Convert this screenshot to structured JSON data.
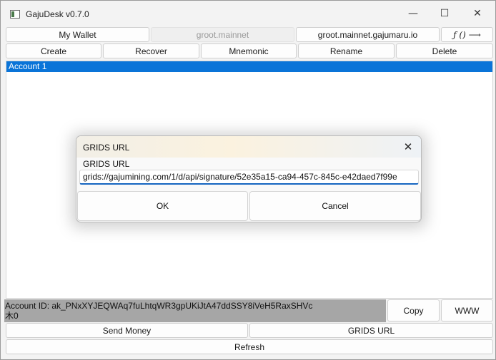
{
  "window": {
    "title": "GajuDesk v0.7.0",
    "minimize": "—",
    "maximize": "☐",
    "close": "✕"
  },
  "toolbar_top": {
    "wallet": "My Wallet",
    "network": "groot.mainnet",
    "node": "groot.mainnet.gajumaru.io",
    "func": "ƒ () ⟶"
  },
  "toolbar_actions": {
    "create": "Create",
    "recover": "Recover",
    "mnemonic": "Mnemonic",
    "rename": "Rename",
    "delete": "Delete"
  },
  "accounts": {
    "items": [
      "Account 1"
    ]
  },
  "account_info": {
    "id_line": "Account ID: ak_PNxXYJEQWAq7fuLhtqWR3gpUKiJtA47ddSSY8iVeH5RaxSHVc",
    "balance_line": "木0",
    "copy": "Copy",
    "www": "WWW"
  },
  "bottom": {
    "send_money": "Send Money",
    "grids_url": "GRIDS URL",
    "refresh": "Refresh"
  },
  "dialog": {
    "title": "GRIDS URL",
    "close": "✕",
    "group_label": "GRIDS URL",
    "url_value": "grids://gajumining.com/1/d/api/signature/52e35a15-ca94-457c-845c-e42daed7f99e",
    "ok": "OK",
    "cancel": "Cancel"
  }
}
